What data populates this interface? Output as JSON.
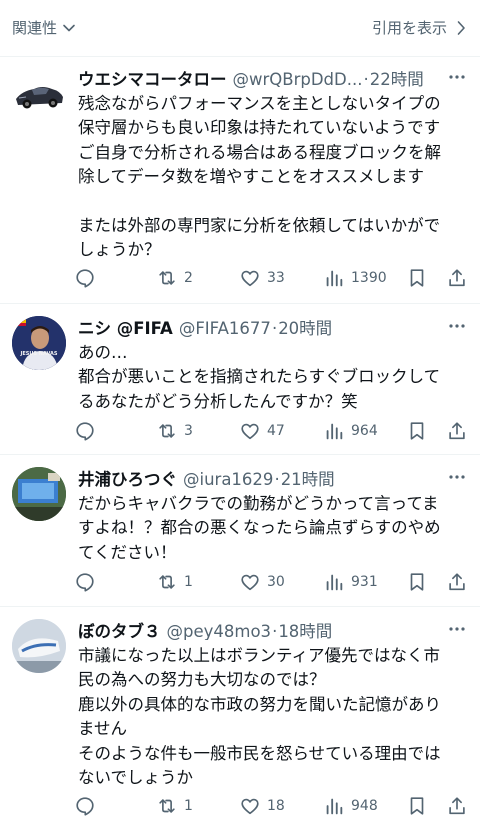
{
  "header": {
    "sort_label": "関連性",
    "quotes_label": "引用を表示"
  },
  "tweets": [
    {
      "display_name": "ウエシマコータロー",
      "handle": "@wrQBrpDdD...",
      "time": "22時間",
      "text_lines": [
        "残念ながらパフォーマンスを主としないタイプの",
        "保守層からも良い印象は持たれていないようです",
        "ご自身で分析される場合はある程度ブロックを解",
        "除してデータ数を増やすことをオススメします",
        "",
        "または外部の専門家に分析を依頼してはいかがで",
        "しょうか？"
      ],
      "replies": "",
      "retweets": "2",
      "likes": "33",
      "views": "1390"
    },
    {
      "display_name": "ニシ @FIFA",
      "handle": "@FIFA1677",
      "time": "20時間",
      "avatar_text": "JESUS NAVAS",
      "text_lines": [
        "あの…",
        "都合が悪いことを指摘されたらすぐブロックして",
        "るあなたがどう分析したんですか？笑"
      ],
      "replies": "",
      "retweets": "3",
      "likes": "47",
      "views": "964"
    },
    {
      "display_name": "井浦ひろつぐ",
      "handle": "@iura1629",
      "time": "21時間",
      "text_lines": [
        "だからキャバクラでの勤務がどうかって言ってま",
        "すよね！？都合の悪くなったら論点ずらすのやめ",
        "てください！"
      ],
      "replies": "",
      "retweets": "1",
      "likes": "30",
      "views": "931"
    },
    {
      "display_name": "ぼのタブ３",
      "handle": "@pey48mo3",
      "time": "18時間",
      "text_lines": [
        "市議になった以上はボランティア優先ではなく市",
        "民の為への努力も大切なのでは？",
        "鹿以外の具体的な市政の努力を聞いた記憶があり",
        "ません",
        "そのような件も一般市民を怒らせている理由では",
        "ないでしょうか"
      ],
      "replies": "",
      "retweets": "1",
      "likes": "18",
      "views": "948"
    }
  ],
  "colors": {
    "text_primary": "#0f1419",
    "text_secondary": "#536471",
    "divider": "#eff3f4"
  }
}
